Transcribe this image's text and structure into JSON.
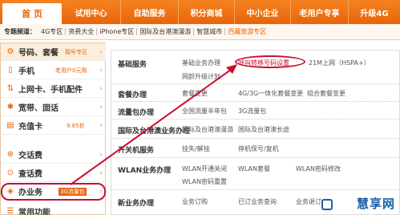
{
  "topnav": {
    "items": [
      "首  页",
      "试用中心",
      "自助服务",
      "积分商城",
      "中小企业",
      "老用户专享",
      "升级4G"
    ]
  },
  "subnav": {
    "title": "专题频道：",
    "links": [
      "4G专区",
      "资费大全",
      "iPhone专区",
      "国际及台港澳漫游",
      "智慧城市",
      "西藏旅游专区"
    ]
  },
  "sidebar": {
    "items": [
      {
        "label": "号码、套餐",
        "badge": "靓号专区",
        "icon": "settings-icon"
      },
      {
        "label": "手机",
        "badge": "老用户0元购",
        "icon": "phone-icon"
      },
      {
        "label": "上网卡、手机配件",
        "badge": "",
        "icon": "network-icon"
      },
      {
        "label": "宽带、固话",
        "badge": "",
        "icon": "broadband-icon"
      },
      {
        "label": "充值卡",
        "badge": "9.85折",
        "icon": "card-icon"
      },
      {
        "label": "交话费",
        "badge": "",
        "icon": "pay-icon"
      },
      {
        "label": "查话费",
        "badge": "",
        "icon": "query-icon"
      },
      {
        "label": "办业务",
        "badge": "3G流量包",
        "icon": "business-icon"
      },
      {
        "label": "常用功能",
        "badge": "",
        "icon": "common-icon"
      }
    ]
  },
  "panel": {
    "rows": [
      {
        "title": "基础服务",
        "links": [
          "基础业务办理",
          "呼叫转移号码设置",
          "21M上网（HSPA+）",
          "网龄升级计划"
        ]
      },
      {
        "title": "套餐办理",
        "links": [
          "套餐变更",
          "4G/3G一体化套餐变更",
          "组合套餐变更"
        ]
      },
      {
        "title": "流量包办理",
        "links": [
          "全国流量半年包",
          "3G流量包"
        ]
      },
      {
        "title": "国际及台港澳业务办理",
        "links": [
          "国际及台港澳漫游",
          "国际及台港澳长途"
        ]
      },
      {
        "title": "开关机服务",
        "links": [
          "挂失/解挂",
          "停机保号/复机"
        ]
      },
      {
        "title": "WLAN业务办理",
        "links": [
          "WLAN开通关闭",
          "WLAN套餐",
          "WLAN密码修改",
          "WLAN密码重置"
        ]
      },
      {
        "title": "新业务办理",
        "links": [
          "业务订购",
          "已订业务查询",
          "业务退订"
        ]
      }
    ]
  },
  "watermark": "慧享网",
  "colors": {
    "brand": "#e8650a",
    "annotation": "#c8102e",
    "watermark": "#1a5fa8"
  }
}
